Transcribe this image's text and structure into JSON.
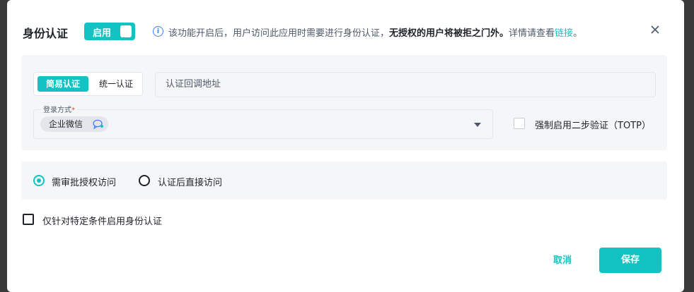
{
  "dialog": {
    "title": "身份认证",
    "toggle": {
      "label": "启用",
      "state": "on"
    },
    "info": {
      "prefix": "该功能开启后，用户访问此应用时需要进行身份认证，",
      "bold": "无授权的用户将被拒之门外。",
      "suffix": "详情请查看",
      "link_text": "链接",
      "end": "。"
    }
  },
  "auth_config": {
    "segment": {
      "active_label": "简易认证",
      "inactive_label": "统一认证"
    },
    "callback_input": {
      "placeholder": "认证回调地址",
      "value": ""
    },
    "login_method": {
      "label": "登录方式",
      "required_mark": "*",
      "selected_tag": "企业微信"
    },
    "totp": {
      "label": "强制启用二步验证（TOTP）",
      "checked": false
    }
  },
  "access_mode": {
    "options": [
      {
        "label": "需审批授权访问",
        "selected": true
      },
      {
        "label": "认证后直接访问",
        "selected": false
      }
    ]
  },
  "condition": {
    "label": "仅针对特定条件启用身份认证",
    "checked": false
  },
  "footer": {
    "cancel_label": "取消",
    "save_label": "保存"
  },
  "colors": {
    "accent": "#13c2c2",
    "info_blue": "#3d7fff"
  }
}
